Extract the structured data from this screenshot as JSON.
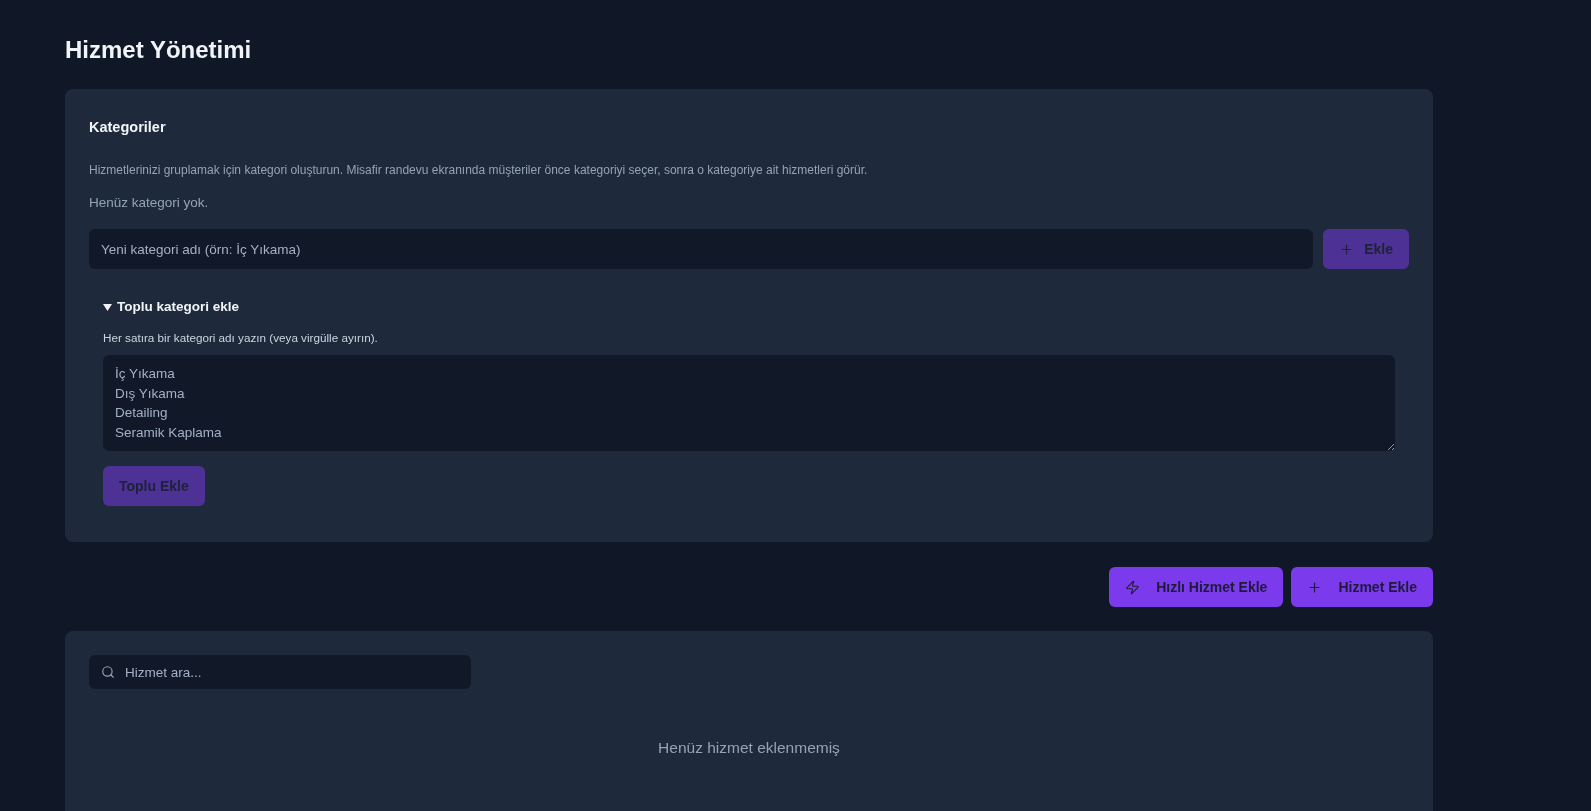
{
  "page": {
    "title": "Hizmet Yönetimi"
  },
  "categories_card": {
    "title": "Kategoriler",
    "description": "Hizmetlerinizi gruplamak için kategori oluşturun. Misafir randevu ekranında müşteriler önce kategoriyi seçer, sonra o kategoriye ait hizmetleri görür.",
    "empty_text": "Henüz kategori yok.",
    "new_category_field": {
      "placeholder": "Yeni kategori adı (örn: İç Yıkama)"
    },
    "add_button": {
      "label": "Ekle",
      "disabled": true
    },
    "bulk_add": {
      "title": "Toplu kategori ekle",
      "expanded": true,
      "hint": "Her satıra bir kategori adı yazın (veya virgülle ayırın).",
      "textarea": {
        "placeholder": "İç Yıkama\nDış Yıkama\nDetailing\nSeramik Kaplama"
      },
      "submit_button": {
        "label": "Toplu Ekle",
        "disabled": true
      }
    }
  },
  "actions": [
    {
      "kind": "quick",
      "label": "Hızlı Hizmet Ekle",
      "disabled": false
    },
    {
      "kind": "add",
      "label": "Hizmet Ekle",
      "disabled": false
    }
  ],
  "services_card": {
    "search": {
      "placeholder": "Hizmet ara..."
    },
    "empty_text": "Henüz hizmet eklenmemiş"
  }
}
